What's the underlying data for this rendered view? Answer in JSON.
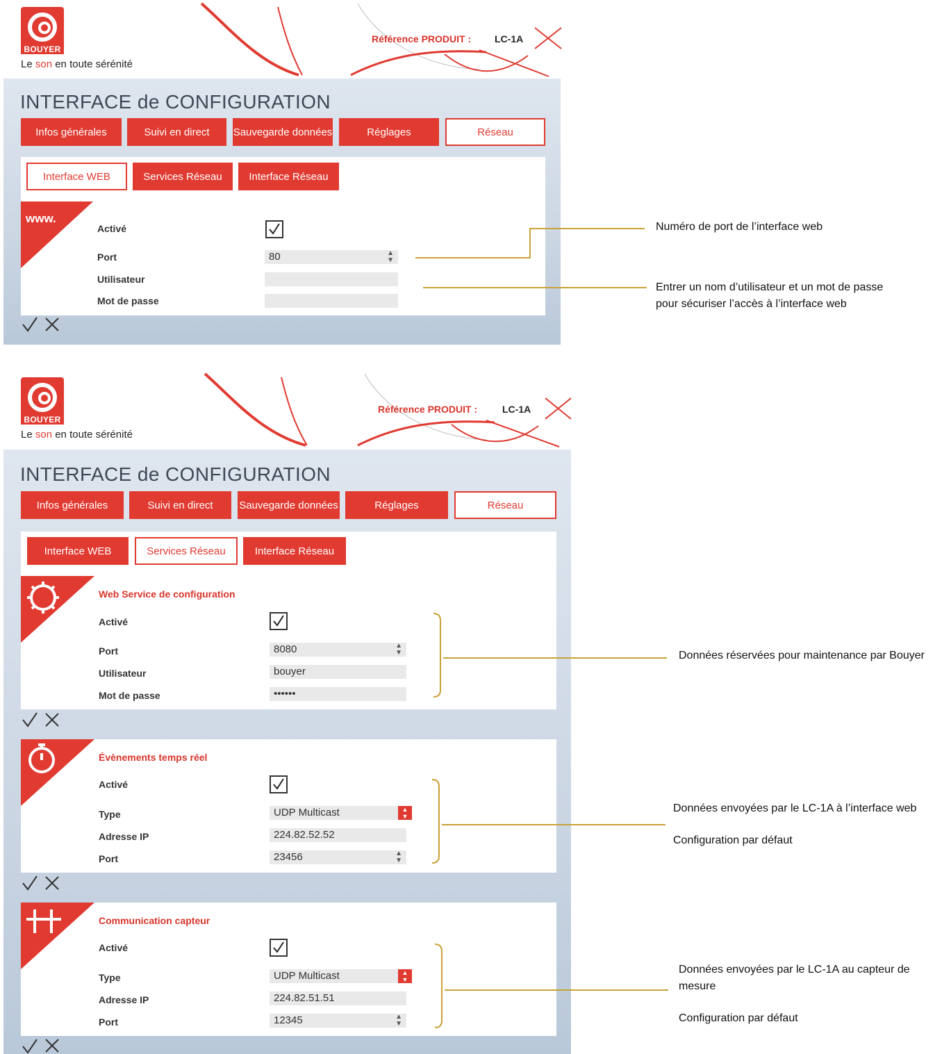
{
  "brand": {
    "logo_text": "BOUYER",
    "tagline_before": "Le ",
    "tagline_red": "son",
    "tagline_after": " en toute sérénité"
  },
  "header": {
    "ref_label": "Référence  PRODUIT :",
    "ref_value": "LC-1A"
  },
  "panel_title": "INTERFACE de CONFIGURATION",
  "main_tabs": [
    "Infos générales",
    "Suivi en direct",
    "Sauvegarde données",
    "Réglages",
    "Réseau"
  ],
  "sub_tabs": [
    "Interface WEB",
    "Services Réseau",
    "Interface Réseau"
  ],
  "screen1": {
    "section_icon_text": "www.",
    "fields": {
      "active_label": "Activé",
      "active_checked": true,
      "port_label": "Port",
      "port_value": "80",
      "user_label": "Utilisateur",
      "user_value": "",
      "password_label": "Mot de passe",
      "password_value": ""
    }
  },
  "screen2": {
    "sections": [
      {
        "title": "Web Service de configuration",
        "icon": "gear-icon",
        "active_label": "Activé",
        "row2_label": "Port",
        "row2_value": "8080",
        "row3_label": "Utilisateur",
        "row3_value": "bouyer",
        "row4_label": "Mot de passe",
        "row4_value": "••••••"
      },
      {
        "title": "Évènements temps réel",
        "icon": "stopwatch-icon",
        "active_label": "Activé",
        "row2_label": "Type",
        "row2_value": "UDP Multicast",
        "row3_label": "Adresse IP",
        "row3_value": "224.82.52.52",
        "row4_label": "Port",
        "row4_value": "23456"
      },
      {
        "title": "Communication capteur",
        "icon": "network-icon",
        "active_label": "Activé",
        "row2_label": "Type",
        "row2_value": "UDP Multicast",
        "row3_label": "Adresse IP",
        "row3_value": "224.82.51.51",
        "row4_label": "Port",
        "row4_value": "12345"
      }
    ]
  },
  "annotations": {
    "a1": "Numéro de port de l’interface web",
    "a2_line1": "Entrer un nom d’utilisateur et un mot de passe",
    "a2_line2": "pour sécuriser l’accès à l’interface web",
    "a3": "Données réservées pour maintenance par Bouyer",
    "a4_line1": "Données envoyées par le LC-1A à l’interface web",
    "a4_line2": "Configuration par défaut",
    "a5_line1": "Données envoyées par le LC-1A au capteur de",
    "a5_line2": "mesure",
    "a5_line3": "Configuration par défaut"
  },
  "colors": {
    "brand_red": "#e03a31",
    "annotation_gold": "#c9a136",
    "panel_blue": "#cbd6e3"
  }
}
